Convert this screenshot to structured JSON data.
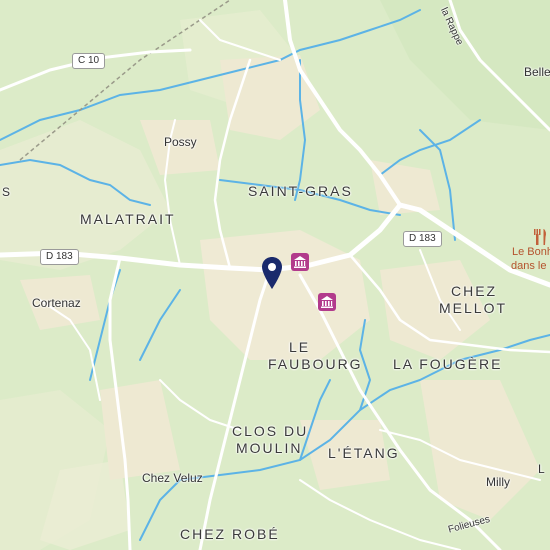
{
  "map": {
    "places_large": [
      {
        "id": "saint-gras",
        "text": "SAINT-GRAS"
      },
      {
        "id": "malatrait",
        "text": "MALATRAIT"
      },
      {
        "id": "chez-mellot-1",
        "text": "CHEZ"
      },
      {
        "id": "chez-mellot-2",
        "text": "MELLOT"
      },
      {
        "id": "le-faubourg-1",
        "text": "LE"
      },
      {
        "id": "le-faubourg-2",
        "text": "FAUBOURG"
      },
      {
        "id": "la-fougere",
        "text": "LA FOUGÈRE"
      },
      {
        "id": "clos-du-moulin-1",
        "text": "CLOS DU"
      },
      {
        "id": "clos-du-moulin-2",
        "text": "MOULIN"
      },
      {
        "id": "l-etang",
        "text": "L'ÉTANG"
      },
      {
        "id": "chez-robe",
        "text": "CHEZ ROBÉ"
      }
    ],
    "places_small": [
      {
        "id": "possy",
        "text": "Possy"
      },
      {
        "id": "cortenaz",
        "text": "Cortenaz"
      },
      {
        "id": "chez-veluz",
        "text": "Chez Veluz"
      },
      {
        "id": "milly",
        "text": "Milly"
      },
      {
        "id": "belle",
        "text": "Belle"
      },
      {
        "id": "s-edge",
        "text": "S"
      },
      {
        "id": "l-edge",
        "text": "L"
      },
      {
        "id": "la-rappe",
        "text": "la Rappe"
      },
      {
        "id": "folieuses",
        "text": "Folieuses"
      }
    ],
    "road_labels": [
      {
        "id": "c10",
        "text": "C 10"
      },
      {
        "id": "d183-west",
        "text": "D 183"
      },
      {
        "id": "d183-east",
        "text": "D 183"
      }
    ],
    "poi": {
      "restaurant_name_1": "Le Bonh",
      "restaurant_name_2": "dans le",
      "restaurant_icon": "fork-knife-icon",
      "museum_icon": "museum-icon",
      "pin_icon": "location-pin-icon"
    },
    "colors": {
      "land": "#dcebc8",
      "water": "#5cb3e6",
      "settlement": "#efead4",
      "roads": "#ffffff",
      "museum": "#b23b8c",
      "restaurant": "#c2603a",
      "pin": "#1a2a6c"
    }
  }
}
